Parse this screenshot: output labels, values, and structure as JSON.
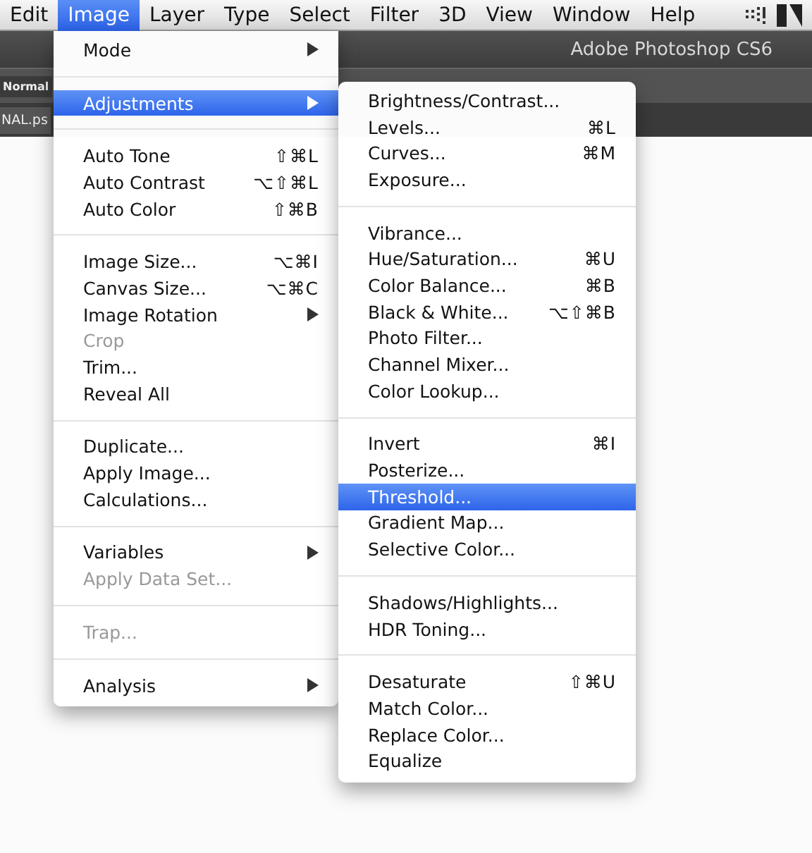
{
  "menu_bar": [
    {
      "label": "Edit",
      "selected": false
    },
    {
      "label": "Image",
      "selected": true
    },
    {
      "label": "Layer",
      "selected": false
    },
    {
      "label": "Type",
      "selected": false
    },
    {
      "label": "Select",
      "selected": false
    },
    {
      "label": "Filter",
      "selected": false
    },
    {
      "label": "3D",
      "selected": false
    },
    {
      "label": "View",
      "selected": false
    },
    {
      "label": "Window",
      "selected": false
    },
    {
      "label": "Help",
      "selected": false
    }
  ],
  "app_bar": {
    "title": "Adobe Photoshop CS6"
  },
  "options_bar": {
    "mode": "Normal"
  },
  "document_tab": {
    "title": "NAL.ps"
  },
  "image_menu": [
    {
      "kind": "item",
      "label": "Mode",
      "submenu": true,
      "selected": false,
      "disabled": false
    },
    {
      "kind": "separator"
    },
    {
      "kind": "item",
      "label": "Adjustments",
      "submenu": true,
      "selected": true,
      "disabled": false
    },
    {
      "kind": "separator"
    },
    {
      "kind": "item",
      "label": "Auto Tone",
      "shortcut": "⇧⌘L",
      "selected": false,
      "disabled": false
    },
    {
      "kind": "item",
      "label": "Auto Contrast",
      "shortcut": "⌥⇧⌘L",
      "selected": false,
      "disabled": false
    },
    {
      "kind": "item",
      "label": "Auto Color",
      "shortcut": "⇧⌘B",
      "selected": false,
      "disabled": false
    },
    {
      "kind": "separator"
    },
    {
      "kind": "item",
      "label": "Image Size...",
      "shortcut": "⌥⌘I",
      "selected": false,
      "disabled": false
    },
    {
      "kind": "item",
      "label": "Canvas Size...",
      "shortcut": "⌥⌘C",
      "selected": false,
      "disabled": false
    },
    {
      "kind": "item",
      "label": "Image Rotation",
      "submenu": true,
      "selected": false,
      "disabled": false
    },
    {
      "kind": "item",
      "label": "Crop",
      "selected": false,
      "disabled": true
    },
    {
      "kind": "item",
      "label": "Trim...",
      "selected": false,
      "disabled": false
    },
    {
      "kind": "item",
      "label": "Reveal All",
      "selected": false,
      "disabled": false
    },
    {
      "kind": "separator"
    },
    {
      "kind": "item",
      "label": "Duplicate...",
      "selected": false,
      "disabled": false
    },
    {
      "kind": "item",
      "label": "Apply Image...",
      "selected": false,
      "disabled": false
    },
    {
      "kind": "item",
      "label": "Calculations...",
      "selected": false,
      "disabled": false
    },
    {
      "kind": "separator"
    },
    {
      "kind": "item",
      "label": "Variables",
      "submenu": true,
      "selected": false,
      "disabled": false
    },
    {
      "kind": "item",
      "label": "Apply Data Set...",
      "selected": false,
      "disabled": true
    },
    {
      "kind": "separator"
    },
    {
      "kind": "item",
      "label": "Trap...",
      "selected": false,
      "disabled": true
    },
    {
      "kind": "separator"
    },
    {
      "kind": "item",
      "label": "Analysis",
      "submenu": true,
      "selected": false,
      "disabled": false
    }
  ],
  "adjustments_menu": [
    {
      "kind": "item",
      "label": "Brightness/Contrast...",
      "selected": false
    },
    {
      "kind": "item",
      "label": "Levels...",
      "shortcut": "⌘L",
      "selected": false
    },
    {
      "kind": "item",
      "label": "Curves...",
      "shortcut": "⌘M",
      "selected": false
    },
    {
      "kind": "item",
      "label": "Exposure...",
      "selected": false
    },
    {
      "kind": "separator"
    },
    {
      "kind": "item",
      "label": "Vibrance...",
      "selected": false
    },
    {
      "kind": "item",
      "label": "Hue/Saturation...",
      "shortcut": "⌘U",
      "selected": false
    },
    {
      "kind": "item",
      "label": "Color Balance...",
      "shortcut": "⌘B",
      "selected": false
    },
    {
      "kind": "item",
      "label": "Black & White...",
      "shortcut": "⌥⇧⌘B",
      "selected": false
    },
    {
      "kind": "item",
      "label": "Photo Filter...",
      "selected": false
    },
    {
      "kind": "item",
      "label": "Channel Mixer...",
      "selected": false
    },
    {
      "kind": "item",
      "label": "Color Lookup...",
      "selected": false
    },
    {
      "kind": "separator"
    },
    {
      "kind": "item",
      "label": "Invert",
      "shortcut": "⌘I",
      "selected": false
    },
    {
      "kind": "item",
      "label": "Posterize...",
      "selected": false
    },
    {
      "kind": "item",
      "label": "Threshold...",
      "selected": true
    },
    {
      "kind": "item",
      "label": "Gradient Map...",
      "selected": false
    },
    {
      "kind": "item",
      "label": "Selective Color...",
      "selected": false
    },
    {
      "kind": "separator"
    },
    {
      "kind": "item",
      "label": "Shadows/Highlights...",
      "selected": false
    },
    {
      "kind": "item",
      "label": "HDR Toning...",
      "selected": false
    },
    {
      "kind": "separator"
    },
    {
      "kind": "item",
      "label": "Desaturate",
      "shortcut": "⇧⌘U",
      "selected": false
    },
    {
      "kind": "item",
      "label": "Match Color...",
      "selected": false
    },
    {
      "kind": "item",
      "label": "Replace Color...",
      "selected": false
    },
    {
      "kind": "item",
      "label": "Equalize",
      "selected": false
    }
  ]
}
